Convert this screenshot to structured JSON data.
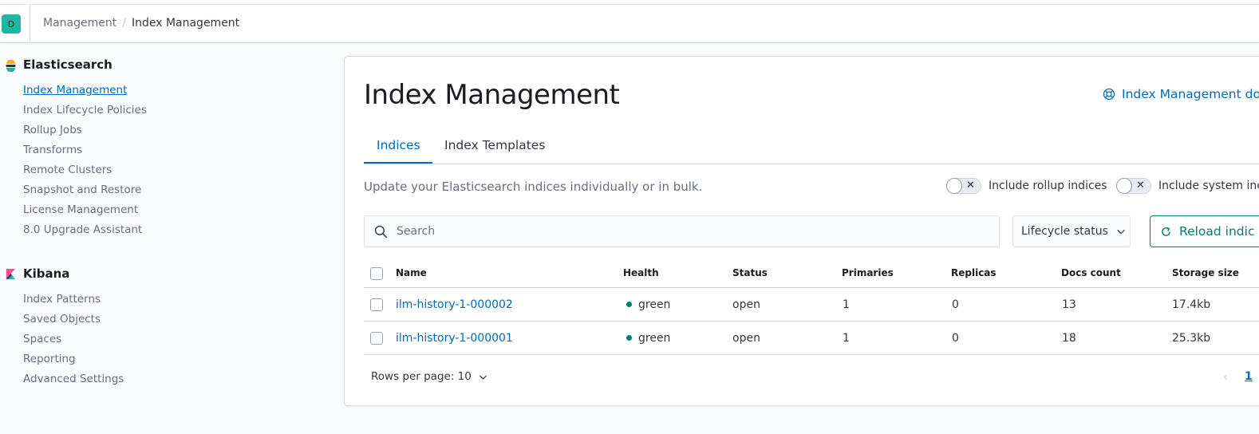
{
  "header": {
    "avatar_initial": "D",
    "breadcrumbs": [
      "Management",
      "/",
      "Index Management"
    ]
  },
  "sidebar": {
    "groups": [
      {
        "title": "Elasticsearch",
        "logo_icon": "elasticsearch-logo-icon",
        "items": [
          {
            "label": "Index Management",
            "active": true
          },
          {
            "label": "Index Lifecycle Policies"
          },
          {
            "label": "Rollup Jobs"
          },
          {
            "label": "Transforms"
          },
          {
            "label": "Remote Clusters"
          },
          {
            "label": "Snapshot and Restore"
          },
          {
            "label": "License Management"
          },
          {
            "label": "8.0 Upgrade Assistant"
          }
        ]
      },
      {
        "title": "Kibana",
        "logo_icon": "kibana-logo-icon",
        "items": [
          {
            "label": "Index Patterns"
          },
          {
            "label": "Saved Objects"
          },
          {
            "label": "Spaces"
          },
          {
            "label": "Reporting"
          },
          {
            "label": "Advanced Settings"
          }
        ]
      }
    ]
  },
  "main": {
    "title": "Index Management",
    "docs_link": "Index Management do",
    "tabs": [
      {
        "label": "Indices",
        "active": true
      },
      {
        "label": "Index Templates"
      }
    ],
    "description": "Update your Elasticsearch indices individually or in bulk.",
    "toggles": [
      {
        "label": "Include rollup indices",
        "checked": false
      },
      {
        "label": "Include system inc",
        "checked": false
      }
    ],
    "search": {
      "placeholder": "Search",
      "value": ""
    },
    "lifecycle_filter": "Lifecycle status",
    "reload_button": "Reload indic",
    "table": {
      "columns": [
        "Name",
        "Health",
        "Status",
        "Primaries",
        "Replicas",
        "Docs count",
        "Storage size"
      ],
      "rows": [
        {
          "name": "ilm-history-1-000002",
          "health": "green",
          "status": "open",
          "primaries": "1",
          "replicas": "0",
          "docs_count": "13",
          "storage_size": "17.4kb"
        },
        {
          "name": "ilm-history-1-000001",
          "health": "green",
          "status": "open",
          "primaries": "1",
          "replicas": "0",
          "docs_count": "18",
          "storage_size": "25.3kb"
        }
      ]
    },
    "pagination": {
      "rows_per_page": "Rows per page: 10",
      "prev_glyph": "‹",
      "current_page": "1"
    }
  },
  "colors": {
    "accent_blue": "#006bb8",
    "health_green": "#017d73",
    "avatar_bg": "#20b6a4"
  }
}
